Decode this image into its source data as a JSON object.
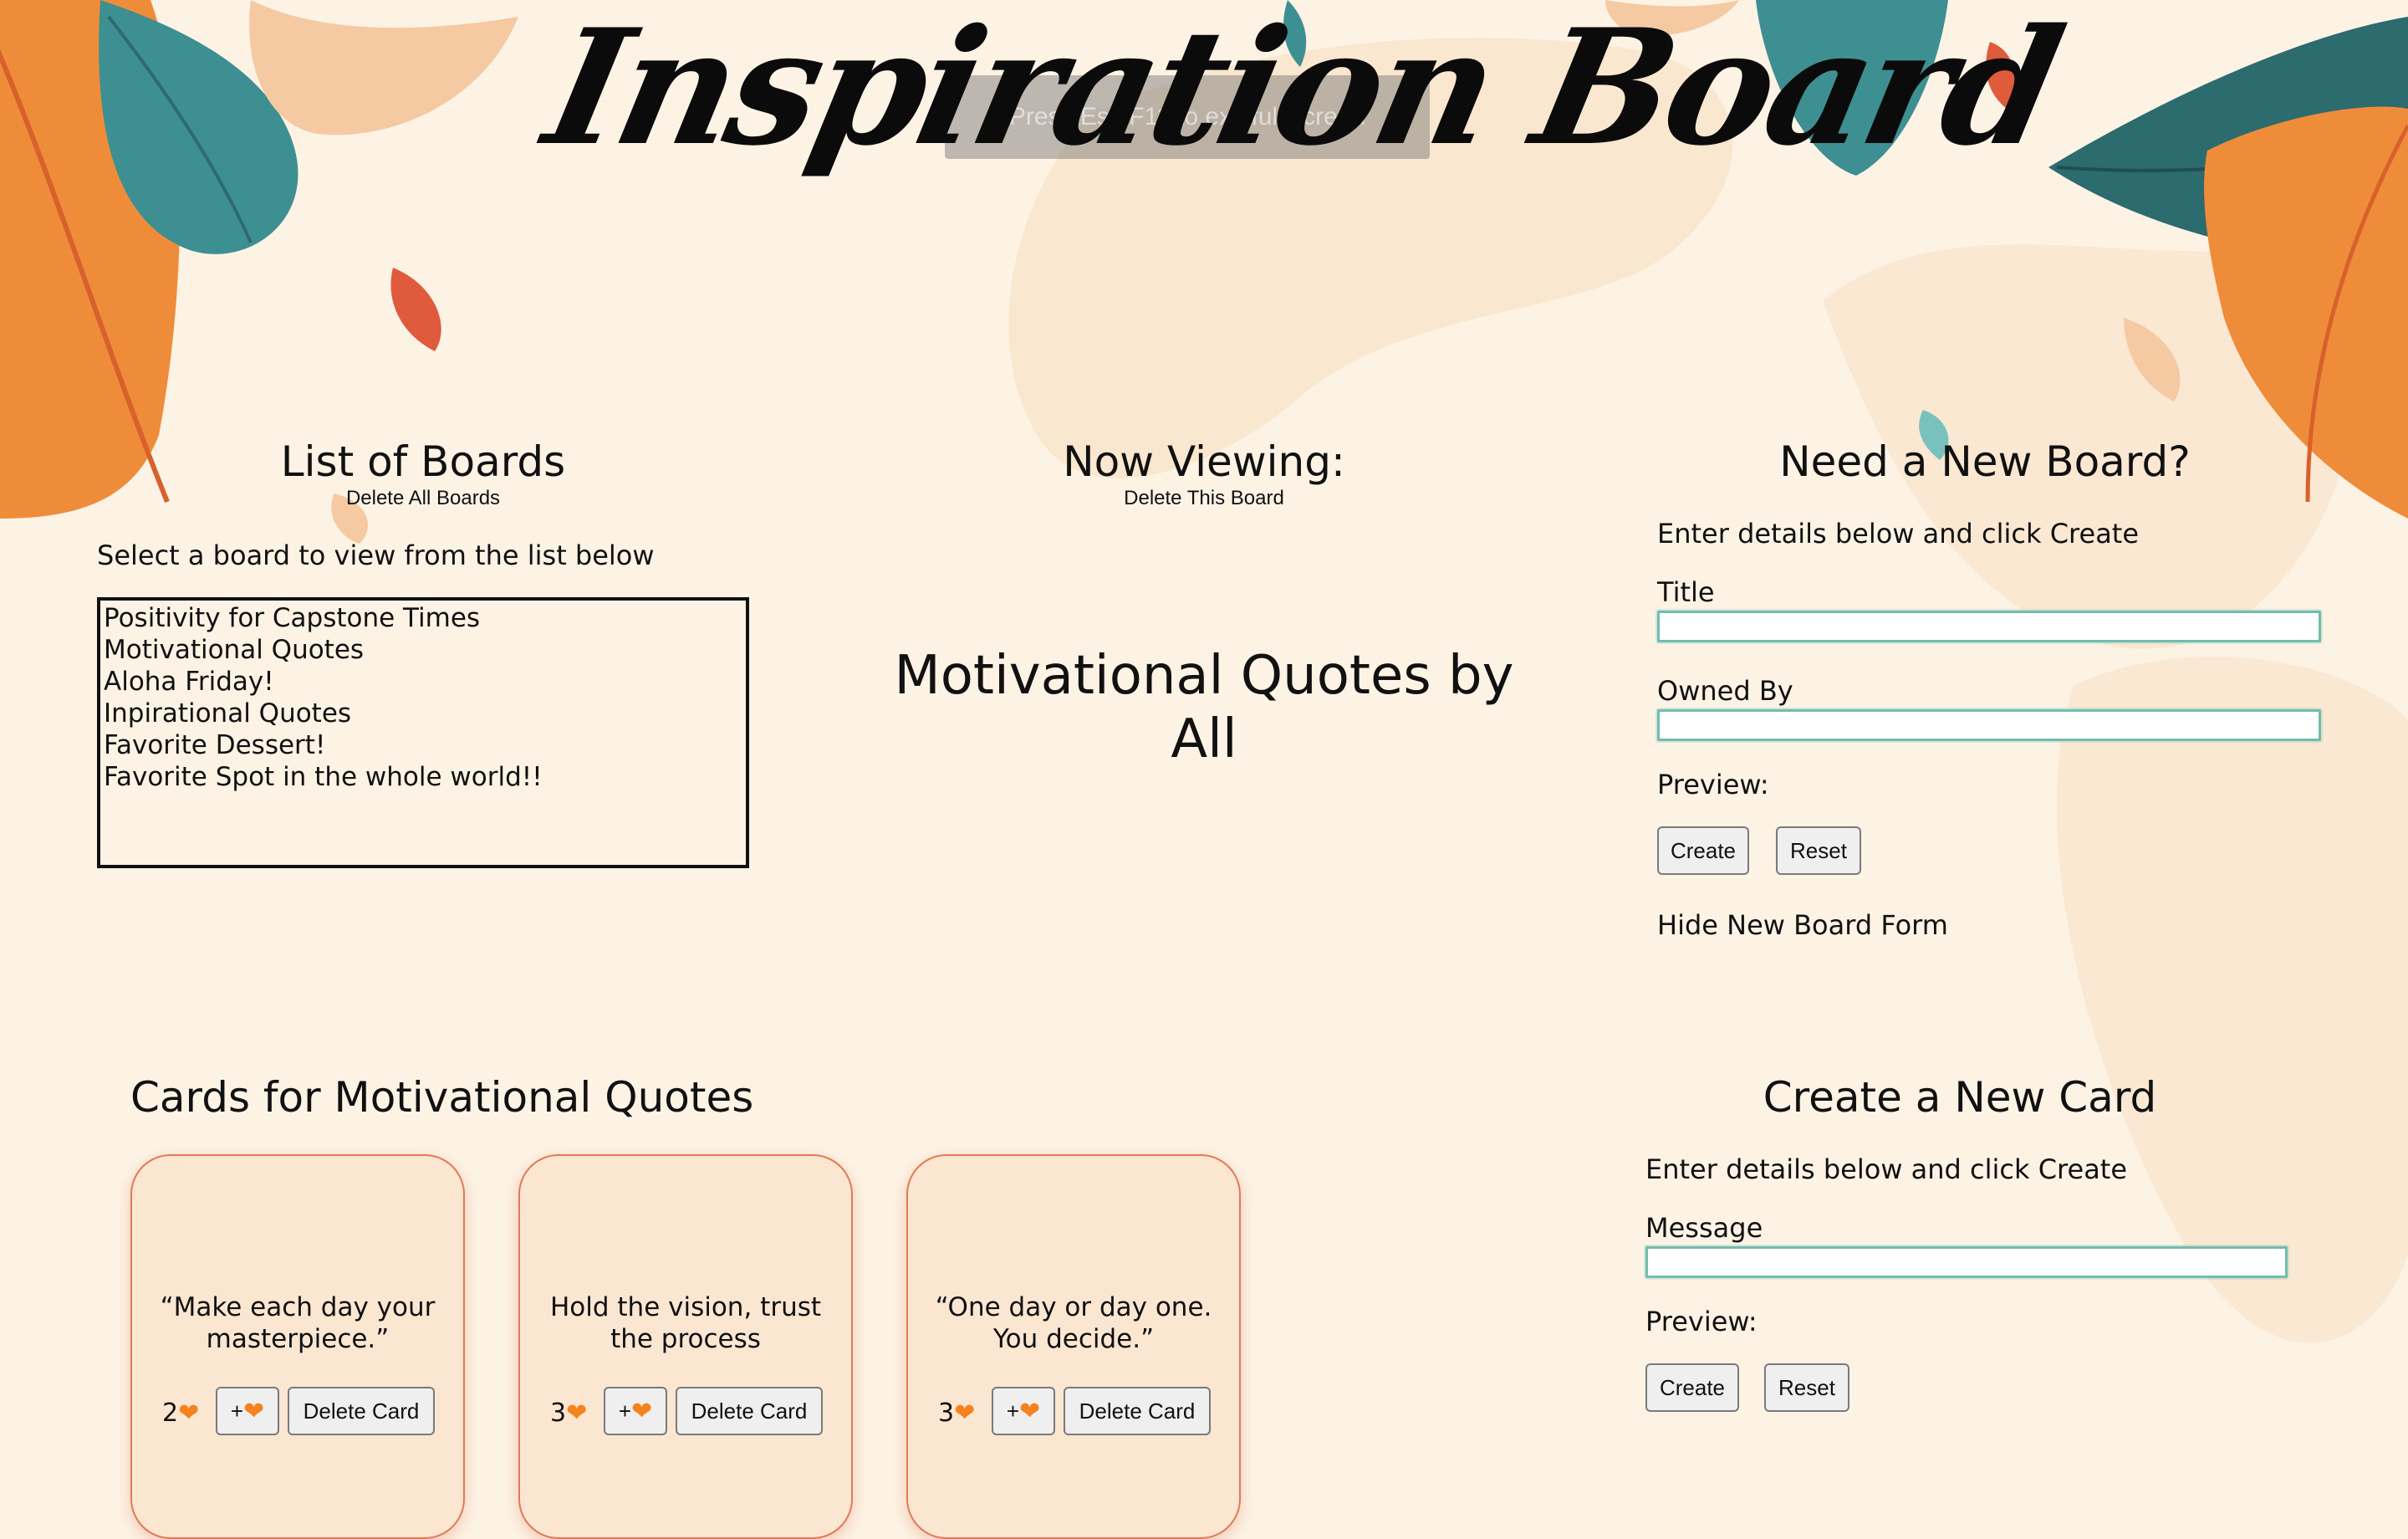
{
  "header": {
    "title": "Inspiration Board",
    "fullscreen_hint": "Press  Esc  F11 to exit full screen"
  },
  "boards_panel": {
    "heading": "List of Boards",
    "delete_all_label": "Delete All Boards",
    "instruction": "Select a board to view from the list below",
    "boards": [
      "Positivity for Capstone Times",
      "Motivational Quotes",
      "Aloha Friday!",
      "Inpirational Quotes",
      "Favorite Dessert!",
      "Favorite Spot in the whole world!!"
    ]
  },
  "viewing_panel": {
    "heading": "Now Viewing:",
    "delete_board_label": "Delete This Board",
    "board_title": "Motivational Quotes by All"
  },
  "new_board_form": {
    "heading": "Need a New Board?",
    "instruction": "Enter details below and click Create",
    "title_label": "Title",
    "title_value": "",
    "owner_label": "Owned By",
    "owner_value": "",
    "preview_label": "Preview:",
    "create_label": "Create",
    "reset_label": "Reset",
    "hide_label": "Hide New Board Form"
  },
  "cards_section": {
    "heading": "Cards for Motivational Quotes",
    "cards": [
      {
        "message": "“Make each day your masterpiece.”",
        "likes": "2",
        "plus_label": "+",
        "delete_label": "Delete Card"
      },
      {
        "message": "Hold the vision, trust the process",
        "likes": "3",
        "plus_label": "+",
        "delete_label": "Delete Card"
      },
      {
        "message": "“One day or day one. You decide.”",
        "likes": "3",
        "plus_label": "+",
        "delete_label": "Delete Card"
      }
    ],
    "heart_icon": "orange-heart-icon"
  },
  "new_card_form": {
    "heading": "Create a New Card",
    "instruction": "Enter details below and click Create",
    "message_label": "Message",
    "message_value": "",
    "preview_label": "Preview:",
    "create_label": "Create",
    "reset_label": "Reset"
  },
  "colors": {
    "background": "#fdf3e5",
    "card_background": "#fbe6d2",
    "card_border": "#e07b55",
    "field_border": "#6fbdb0",
    "heart": "#f5821f",
    "leaf_teal": "#3e8f92",
    "leaf_orange": "#ef8c3a"
  }
}
